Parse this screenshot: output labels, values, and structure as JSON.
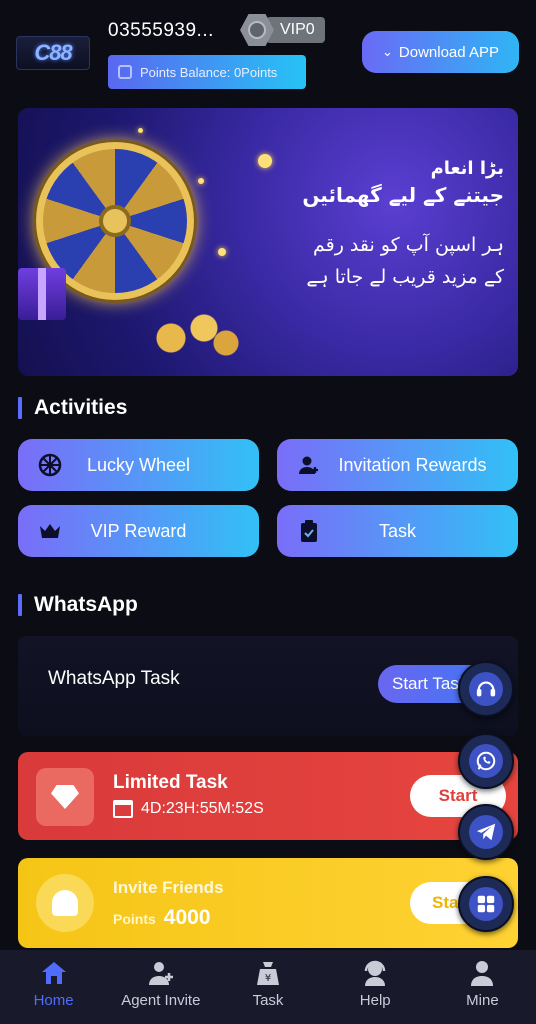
{
  "header": {
    "logo_text": "C88",
    "phone": "03555939...",
    "vip_level": "VIP0",
    "points_balance": "Points Balance: 0Points",
    "download_label": "Download APP"
  },
  "banner": {
    "line1": "بڑا انعام",
    "line2": "جیتنے کے لیے گھمائیں",
    "line3": "ہر اسپن آپ کو نقد رقم",
    "line4": "کے مزید قریب لے جاتا ہے"
  },
  "activities": {
    "title": "Activities",
    "items": [
      {
        "label": "Lucky Wheel",
        "icon": "wheel-icon"
      },
      {
        "label": "Invitation Rewards",
        "icon": "user-plus-icon"
      },
      {
        "label": "VIP Reward",
        "icon": "crown-icon"
      },
      {
        "label": "Task",
        "icon": "clipboard-check-icon"
      }
    ]
  },
  "whatsapp": {
    "title": "WhatsApp",
    "task_label": "WhatsApp Task",
    "start_label": "Start Task"
  },
  "limited_task": {
    "title": "Limited Task",
    "countdown": "4D:23H:55M:52S",
    "button": "Start"
  },
  "invite_friends": {
    "title": "Invite Friends",
    "points_label": "Points",
    "points_value": "4000",
    "button": "Start"
  },
  "floating": [
    "support-icon",
    "whatsapp-icon",
    "telegram-icon",
    "apps-grid-icon"
  ],
  "nav": {
    "items": [
      {
        "label": "Home",
        "icon": "home-icon",
        "active": true
      },
      {
        "label": "Agent Invite",
        "icon": "agent-invite-icon",
        "active": false
      },
      {
        "label": "Task",
        "icon": "task-bag-icon",
        "active": false
      },
      {
        "label": "Help",
        "icon": "help-icon",
        "active": false
      },
      {
        "label": "Mine",
        "icon": "user-icon",
        "active": false
      }
    ]
  },
  "colors": {
    "background": "#0c0c14",
    "accent_gradient_start": "#7a6df8",
    "accent_gradient_end": "#32c0f6",
    "limited_task_red": "#e0403b",
    "invite_yellow": "#f5c516",
    "nav_active": "#4f6cff"
  }
}
